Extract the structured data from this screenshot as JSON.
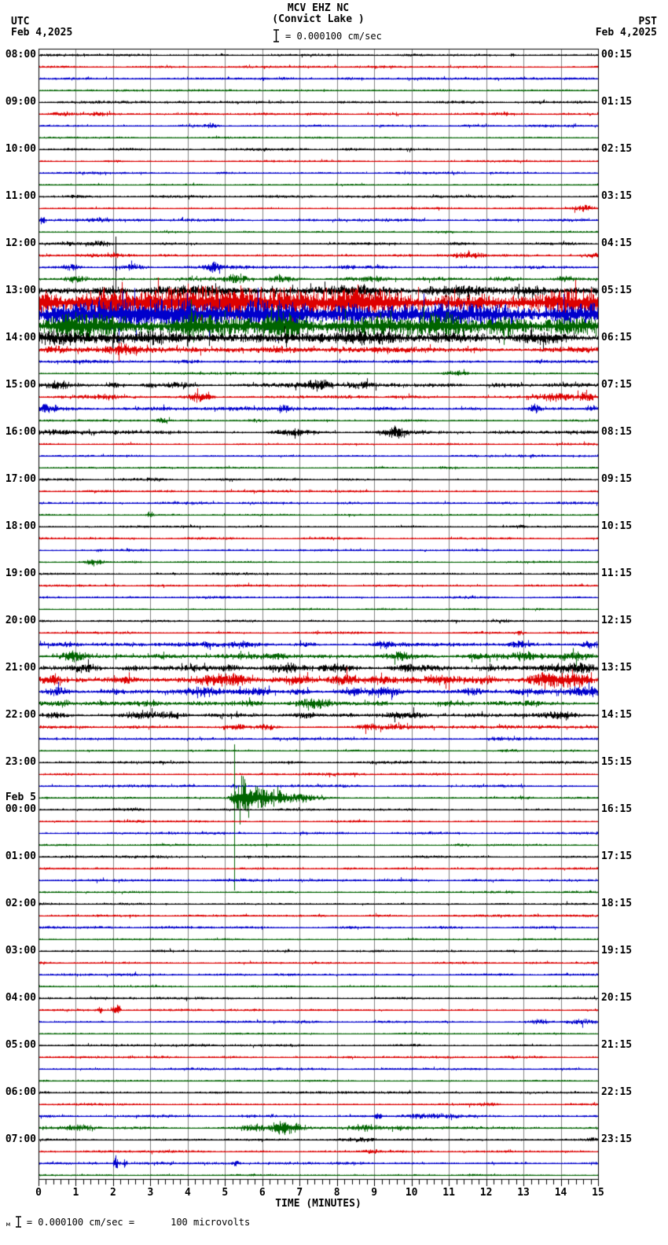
{
  "header": {
    "station": "MCV EHZ NC",
    "location": "(Convict Lake )",
    "scale_text": "= 0.000100 cm/sec",
    "left_tz": "UTC",
    "left_date": "Feb 4,2025",
    "right_tz": "PST",
    "right_date": "Feb 4,2025"
  },
  "footer": {
    "xlabel": "TIME (MINUTES)",
    "marker": "м",
    "scale_note": "= 0.000100 cm/sec =",
    "scale_note2": "100 microvolts"
  },
  "chart_data": {
    "type": "line",
    "title": "MCV EHZ NC (Convict Lake ) helicorder, 24 hours, 15 minutes per trace",
    "xlabel": "TIME (MINUTES)",
    "x_range": [
      0,
      15
    ],
    "x_ticks": [
      0,
      1,
      2,
      3,
      4,
      5,
      6,
      7,
      8,
      9,
      10,
      11,
      12,
      13,
      14,
      15
    ],
    "minor_tick_minutes": 0.2,
    "minutes_per_row": 15,
    "grid": true,
    "row_cycle": [
      "black",
      "red",
      "blue",
      "green"
    ],
    "colors": {
      "black": "#000000",
      "red": "#dd0000",
      "blue": "#0000cc",
      "green": "#006400",
      "grid": "#808080"
    },
    "amplitude_units": "px_half_amplitude_estimate",
    "rows": [
      {
        "utc": "08:00",
        "pst": "00:15",
        "a": 1.3,
        "e": [
          [
            12.7,
            0.06,
            3
          ]
        ]
      },
      {
        "a": 1.2
      },
      {
        "a": 1.3
      },
      {
        "a": 1.0
      },
      {
        "utc": "09:00",
        "pst": "01:15",
        "a": 1.3
      },
      {
        "a": 1.4,
        "e": [
          [
            0.6,
            0.3,
            1.5
          ],
          [
            1.6,
            0.25,
            1.5
          ]
        ]
      },
      {
        "a": 1.3,
        "e": [
          [
            4.6,
            0.18,
            3
          ]
        ]
      },
      {
        "a": 1.0
      },
      {
        "utc": "10:00",
        "pst": "02:15",
        "a": 1.3
      },
      {
        "a": 1.2,
        "e": [
          [
            2.0,
            0.3,
            1.2
          ]
        ]
      },
      {
        "a": 1.3
      },
      {
        "a": 1.0
      },
      {
        "utc": "11:00",
        "pst": "03:15",
        "a": 1.3,
        "e": [
          [
            1.0,
            0.2,
            1.5
          ]
        ]
      },
      {
        "a": 1.2,
        "e": [
          [
            14.6,
            0.25,
            4
          ]
        ]
      },
      {
        "a": 1.5,
        "e": [
          [
            0.08,
            0.12,
            5
          ],
          [
            1.6,
            0.3,
            1.5
          ]
        ]
      },
      {
        "a": 1.0
      },
      {
        "utc": "12:00",
        "pst": "04:15",
        "a": 1.6,
        "e": [
          [
            0.9,
            0.3,
            1.5
          ],
          [
            1.6,
            0.3,
            2
          ],
          [
            11.3,
            0.4,
            1.5
          ]
        ],
        "v": [
          [
            2.07,
            9,
            63
          ]
        ]
      },
      {
        "a": 1.4,
        "e": [
          [
            1.4,
            0.5,
            1.5
          ],
          [
            2.1,
            0.2,
            2
          ],
          [
            11.5,
            0.4,
            2.5
          ],
          [
            14.9,
            0.2,
            2.5
          ]
        ]
      },
      {
        "a": 1.6,
        "e": [
          [
            0.9,
            0.2,
            3
          ],
          [
            2.5,
            0.3,
            2.5
          ],
          [
            4.7,
            0.22,
            5
          ],
          [
            8.3,
            0.3,
            1.5
          ]
        ]
      },
      {
        "a": 1.7,
        "e": [
          [
            1.0,
            0.3,
            3.5
          ],
          [
            5.3,
            0.3,
            4.5
          ],
          [
            6.5,
            0.3,
            2.5
          ],
          [
            9.0,
            0.4,
            2.5
          ],
          [
            12.5,
            0.3,
            2.5
          ],
          [
            14.1,
            0.2,
            3.5
          ]
        ]
      },
      {
        "utc": "13:00",
        "pst": "05:15",
        "a": 3.5,
        "e": [
          [
            1.9,
            0.4,
            3.5
          ],
          [
            4.0,
            1.0,
            2.5
          ],
          [
            8.0,
            1.5,
            2.5
          ],
          [
            11.5,
            1.0,
            3.5
          ],
          [
            13.0,
            0.5,
            3.5
          ]
        ]
      },
      {
        "a": 15
      },
      {
        "a": 14
      },
      {
        "a": 13
      },
      {
        "utc": "14:00",
        "pst": "06:15",
        "a": 5.5,
        "e": [
          [
            0.4,
            0.5,
            3.5
          ],
          [
            2.5,
            0.7,
            3.5
          ],
          [
            6.0,
            1.0,
            2.5
          ],
          [
            9.0,
            1.0,
            2.5
          ],
          [
            13.5,
            0.7,
            3.5
          ]
        ]
      },
      {
        "a": 2.6,
        "e": [
          [
            0.5,
            0.3,
            2.5
          ],
          [
            2.3,
            0.4,
            5.5
          ],
          [
            6.5,
            1.0,
            1.5
          ]
        ]
      },
      {
        "a": 1.6,
        "e": [
          [
            4.0,
            0.3,
            1.5
          ],
          [
            9.5,
            0.3,
            1.5
          ]
        ]
      },
      {
        "a": 1.2,
        "e": [
          [
            11.2,
            0.3,
            2.5
          ]
        ]
      },
      {
        "utc": "15:00",
        "pst": "07:15",
        "a": 2.2,
        "e": [
          [
            0.5,
            0.3,
            2.5
          ],
          [
            2.0,
            0.2,
            3.5
          ],
          [
            3.0,
            0.2,
            2.5
          ],
          [
            3.7,
            0.3,
            3.5
          ],
          [
            7.5,
            0.4,
            6.5
          ],
          [
            8.7,
            0.3,
            3.5
          ]
        ]
      },
      {
        "a": 1.7,
        "e": [
          [
            1.8,
            0.3,
            1.5
          ],
          [
            4.3,
            0.3,
            4.5
          ],
          [
            13.8,
            0.5,
            3.5
          ],
          [
            14.7,
            0.3,
            4.5
          ]
        ]
      },
      {
        "a": 1.8,
        "e": [
          [
            0.12,
            0.15,
            6.5
          ],
          [
            0.5,
            0.3,
            2.5
          ],
          [
            6.6,
            0.2,
            3.5
          ],
          [
            13.3,
            0.15,
            5.5
          ],
          [
            14.9,
            0.2,
            2.5
          ]
        ]
      },
      {
        "a": 1.2,
        "e": [
          [
            3.3,
            0.2,
            2.5
          ],
          [
            5.8,
            0.4,
            1.5
          ]
        ]
      },
      {
        "utc": "16:00",
        "pst": "08:15",
        "a": 1.8,
        "e": [
          [
            0.5,
            0.5,
            1.5
          ],
          [
            6.8,
            0.4,
            3.5
          ],
          [
            9.55,
            0.3,
            6.5
          ]
        ]
      },
      {
        "a": 1.2
      },
      {
        "a": 1.3
      },
      {
        "a": 1.0,
        "e": [
          [
            11.0,
            0.3,
            1.2
          ]
        ]
      },
      {
        "utc": "17:00",
        "pst": "09:15",
        "a": 1.3,
        "e": [
          [
            3.2,
            0.3,
            1.5
          ]
        ]
      },
      {
        "a": 1.2
      },
      {
        "a": 1.3
      },
      {
        "a": 1.0,
        "e": [
          [
            3.0,
            0.08,
            5
          ]
        ]
      },
      {
        "utc": "18:00",
        "pst": "10:15",
        "a": 1.3,
        "e": [
          [
            12.9,
            0.2,
            1.5
          ]
        ]
      },
      {
        "a": 1.2
      },
      {
        "a": 1.3
      },
      {
        "a": 1.1,
        "e": [
          [
            1.45,
            0.28,
            4.5
          ]
        ]
      },
      {
        "utc": "19:00",
        "pst": "11:15",
        "a": 1.3
      },
      {
        "a": 1.2
      },
      {
        "a": 1.3
      },
      {
        "a": 1.0
      },
      {
        "utc": "20:00",
        "pst": "12:15",
        "a": 1.3,
        "e": [
          [
            12.5,
            0.2,
            1.5
          ]
        ]
      },
      {
        "a": 1.2,
        "e": [
          [
            12.9,
            0.1,
            2.5
          ]
        ]
      },
      {
        "a": 2.0,
        "e": [
          [
            0.8,
            0.3,
            2.5
          ],
          [
            4.5,
            0.2,
            2.5
          ],
          [
            5.3,
            0.4,
            3.5
          ],
          [
            7.2,
            0.3,
            2.5
          ],
          [
            9.3,
            0.3,
            3.5
          ],
          [
            12.9,
            0.3,
            3.5
          ],
          [
            14.8,
            0.2,
            3.5
          ]
        ]
      },
      {
        "a": 2.2,
        "e": [
          [
            0.95,
            0.35,
            6.5
          ],
          [
            3.4,
            0.4,
            2.5
          ],
          [
            5.5,
            0.4,
            2.5
          ],
          [
            6.3,
            0.3,
            2.5
          ],
          [
            9.7,
            0.4,
            3.5
          ],
          [
            11.8,
            0.3,
            2.5
          ],
          [
            13.1,
            0.5,
            4.5
          ],
          [
            14.3,
            0.4,
            4.5
          ]
        ]
      },
      {
        "utc": "21:00",
        "pst": "13:15",
        "a": 2.5,
        "e": [
          [
            1.3,
            0.4,
            3.5
          ],
          [
            2.5,
            0.3,
            2.5
          ],
          [
            4.2,
            0.4,
            2.5
          ],
          [
            5.2,
            0.3,
            2.5
          ],
          [
            6.6,
            0.4,
            3.5
          ],
          [
            8.1,
            0.4,
            3.5
          ],
          [
            9.9,
            0.4,
            3.5
          ],
          [
            12.1,
            0.3,
            2.5
          ],
          [
            13.9,
            0.6,
            4.5
          ],
          [
            14.6,
            0.3,
            3.5
          ]
        ]
      },
      {
        "a": 3.0,
        "e": [
          [
            0.3,
            0.3,
            3.5
          ],
          [
            2.2,
            0.4,
            3.5
          ],
          [
            4.6,
            0.5,
            4.5
          ],
          [
            5.3,
            0.3,
            3.5
          ],
          [
            6.9,
            0.4,
            4.5
          ],
          [
            8.3,
            0.4,
            4.5
          ],
          [
            9.2,
            0.3,
            3.5
          ],
          [
            10.9,
            0.4,
            3.5
          ],
          [
            12.0,
            0.3,
            3.5
          ],
          [
            13.6,
            0.5,
            7.5
          ],
          [
            14.4,
            0.4,
            5.5
          ]
        ]
      },
      {
        "a": 2.5,
        "e": [
          [
            0.5,
            0.3,
            3.5
          ],
          [
            2.0,
            0.3,
            2.5
          ],
          [
            4.4,
            0.4,
            3.5
          ],
          [
            5.9,
            0.4,
            3.5
          ],
          [
            7.0,
            0.3,
            3.5
          ],
          [
            8.4,
            0.4,
            4.5
          ],
          [
            9.3,
            0.4,
            4.5
          ],
          [
            11.6,
            0.3,
            3.5
          ],
          [
            13.0,
            0.3,
            2.5
          ],
          [
            14.6,
            0.4,
            4.5
          ]
        ]
      },
      {
        "a": 2.2,
        "e": [
          [
            0.6,
            0.3,
            2.5
          ],
          [
            2.9,
            0.4,
            2.5
          ],
          [
            5.6,
            0.4,
            2.5
          ],
          [
            7.3,
            0.4,
            5.5
          ],
          [
            9.1,
            0.3,
            2.5
          ],
          [
            11.2,
            0.4,
            2.5
          ],
          [
            13.3,
            0.3,
            2.5
          ]
        ]
      },
      {
        "utc": "22:00",
        "pst": "14:15",
        "a": 2.2,
        "e": [
          [
            0.5,
            0.3,
            2.5
          ],
          [
            2.8,
            0.4,
            3.5
          ],
          [
            3.6,
            0.3,
            2.5
          ],
          [
            7.1,
            0.4,
            2.5
          ],
          [
            9.8,
            0.5,
            3.5
          ],
          [
            14.0,
            0.4,
            3.5
          ]
        ]
      },
      {
        "a": 1.8,
        "e": [
          [
            5.3,
            0.3,
            2.5
          ],
          [
            6.1,
            0.3,
            2.5
          ],
          [
            8.9,
            0.4,
            3.5
          ],
          [
            9.6,
            0.3,
            2.5
          ],
          [
            12.5,
            0.3,
            1.5
          ]
        ]
      },
      {
        "a": 1.4,
        "e": [
          [
            12.3,
            0.3,
            1.5
          ]
        ]
      },
      {
        "a": 1.1,
        "e": [
          [
            12.6,
            0.3,
            1.5
          ]
        ]
      },
      {
        "utc": "23:00",
        "pst": "15:15",
        "a": 1.4
      },
      {
        "a": 1.3
      },
      {
        "a": 1.4,
        "e": [
          [
            5.25,
            0.1,
            2.5
          ]
        ]
      },
      {
        "a": 1.1,
        "e": [
          [
            5.45,
            0.22,
            22
          ],
          [
            5.8,
            0.35,
            12
          ],
          [
            6.2,
            0.4,
            7
          ],
          [
            6.7,
            0.5,
            4
          ],
          [
            7.3,
            0.5,
            2.5
          ],
          [
            13.0,
            0.3,
            1.5
          ]
        ],
        "v": [
          [
            5.25,
            68,
            118
          ]
        ]
      },
      {
        "utc": "00:00",
        "utc2": "Feb 5",
        "pst": "16:15",
        "a": 1.3
      },
      {
        "a": 1.3
      },
      {
        "a": 1.3
      },
      {
        "a": 1.0,
        "e": [
          [
            11.3,
            0.2,
            1.5
          ]
        ]
      },
      {
        "utc": "01:00",
        "pst": "17:15",
        "a": 1.3
      },
      {
        "a": 1.2
      },
      {
        "a": 1.3
      },
      {
        "a": 1.0
      },
      {
        "utc": "02:00",
        "pst": "18:15",
        "a": 1.3
      },
      {
        "a": 1.2
      },
      {
        "a": 1.3
      },
      {
        "a": 1.0
      },
      {
        "utc": "03:00",
        "pst": "19:15",
        "a": 1.3
      },
      {
        "a": 1.2
      },
      {
        "a": 1.3
      },
      {
        "a": 1.0
      },
      {
        "utc": "04:00",
        "pst": "20:15",
        "a": 1.3
      },
      {
        "a": 1.2,
        "e": [
          [
            1.63,
            0.05,
            5
          ],
          [
            2.07,
            0.09,
            8
          ]
        ]
      },
      {
        "a": 1.3,
        "e": [
          [
            13.4,
            0.3,
            2.5
          ],
          [
            14.6,
            0.4,
            2.5
          ]
        ]
      },
      {
        "a": 1.0
      },
      {
        "utc": "05:00",
        "pst": "21:15",
        "a": 1.3
      },
      {
        "a": 1.2
      },
      {
        "a": 1.3
      },
      {
        "a": 1.0
      },
      {
        "utc": "06:00",
        "pst": "22:15",
        "a": 1.3
      },
      {
        "a": 1.2,
        "e": [
          [
            12.1,
            0.3,
            1.5
          ]
        ]
      },
      {
        "a": 1.5,
        "e": [
          [
            9.1,
            0.08,
            5.5
          ],
          [
            10.2,
            0.5,
            2.5
          ],
          [
            11.0,
            0.3,
            1.5
          ]
        ]
      },
      {
        "a": 1.6,
        "e": [
          [
            1.2,
            0.4,
            2.5
          ],
          [
            5.8,
            0.4,
            3.5
          ],
          [
            6.5,
            0.3,
            7.5
          ],
          [
            6.9,
            0.3,
            4.5
          ],
          [
            8.7,
            0.5,
            3.5
          ],
          [
            9.8,
            0.3,
            2.5
          ]
        ]
      },
      {
        "utc": "07:00",
        "pst": "23:15",
        "a": 1.3,
        "e": [
          [
            8.6,
            0.4,
            2
          ],
          [
            14.8,
            0.2,
            1.5
          ]
        ]
      },
      {
        "a": 1.2,
        "e": [
          [
            8.9,
            0.3,
            1.5
          ]
        ]
      },
      {
        "a": 1.4,
        "e": [
          [
            2.07,
            0.07,
            7
          ],
          [
            2.3,
            0.07,
            5
          ],
          [
            5.3,
            0.09,
            3.5
          ]
        ]
      },
      {
        "a": 1.0
      }
    ]
  }
}
